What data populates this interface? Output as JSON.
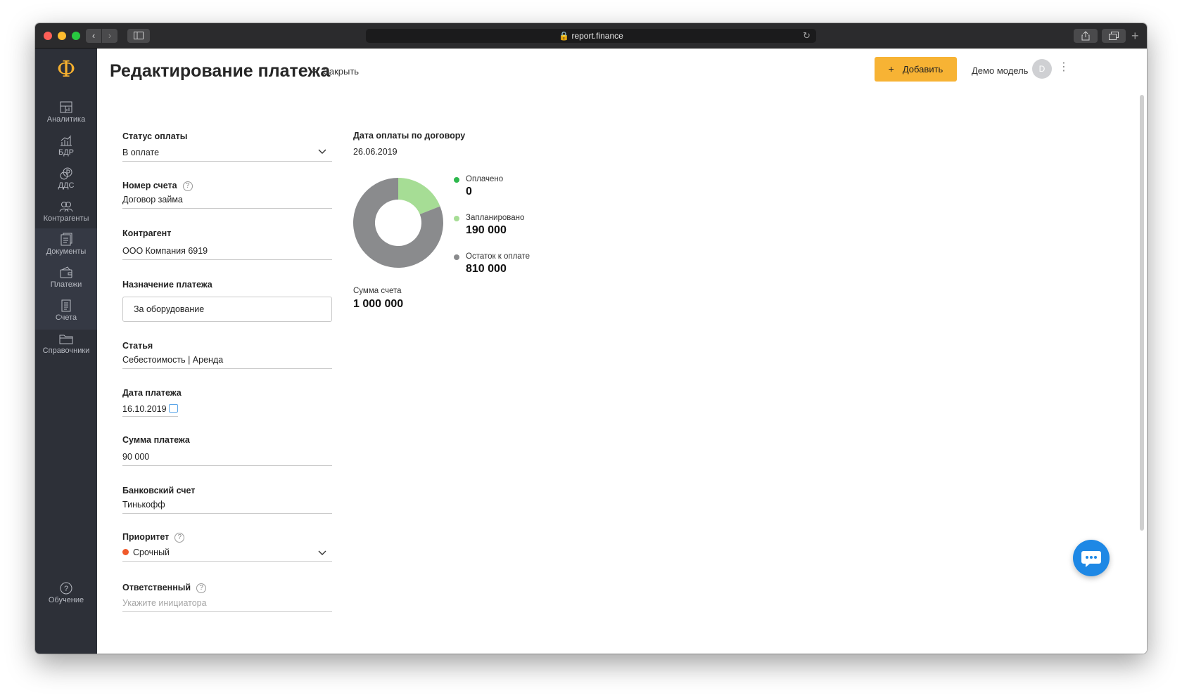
{
  "browser": {
    "url": "report.finance",
    "back_icon": "chevron-left-icon",
    "forward_icon": "chevron-right-icon"
  },
  "sidebar": {
    "logo": "Ф",
    "items": [
      {
        "label": "Аналитика",
        "icon": "analytics-icon"
      },
      {
        "label": "БДР",
        "icon": "chart-icon"
      },
      {
        "label": "ДДС",
        "icon": "cashflow-icon"
      },
      {
        "label": "Контрагенты",
        "icon": "people-icon"
      },
      {
        "label": "Документы",
        "icon": "documents-icon"
      },
      {
        "label": "Платежи",
        "icon": "wallet-icon"
      },
      {
        "label": "Счета",
        "icon": "invoice-icon"
      },
      {
        "label": "Справочники",
        "icon": "folder-icon"
      }
    ],
    "help": {
      "label": "Обучение",
      "icon": "question-icon"
    }
  },
  "header": {
    "title": "Редактирование платежа",
    "close_label": "Закрыть",
    "add_label": "Добавить",
    "user_name": "Демо модель",
    "avatar_initial": "D"
  },
  "form": {
    "status": {
      "label": "Статус оплаты",
      "value": "В оплате"
    },
    "invoice_number": {
      "label": "Номер счета",
      "value": "Договор займа"
    },
    "counterparty": {
      "label": "Контрагент",
      "value": "ООО Компания 6919"
    },
    "purpose": {
      "label": "Назначение платежа",
      "value": "За оборудование"
    },
    "article": {
      "label": "Статья",
      "value": "Себестоимость | Аренда"
    },
    "payment_date": {
      "label": "Дата платежа",
      "value": "16.10.2019"
    },
    "amount": {
      "label": "Сумма платежа",
      "value": "90 000"
    },
    "bank_account": {
      "label": "Банковский счет",
      "value": "Тинькофф"
    },
    "priority": {
      "label": "Приоритет",
      "value": "Срочный",
      "color": "#f0592a"
    },
    "responsible": {
      "label": "Ответственный",
      "placeholder": "Укажите инициатора"
    }
  },
  "summary": {
    "contract_date_label": "Дата оплаты по договору",
    "contract_date": "26.06.2019",
    "total_label": "Сумма счета",
    "total_value": "1 000 000"
  },
  "chart_data": {
    "type": "pie",
    "donut": true,
    "categories": [
      "Оплачено",
      "Запланировано",
      "Остаток к оплате"
    ],
    "values": [
      0,
      190000,
      810000
    ],
    "value_labels": [
      "0",
      "190 000",
      "810 000"
    ],
    "colors": [
      "#2db84d",
      "#a6dd95",
      "#8a8b8d"
    ]
  }
}
